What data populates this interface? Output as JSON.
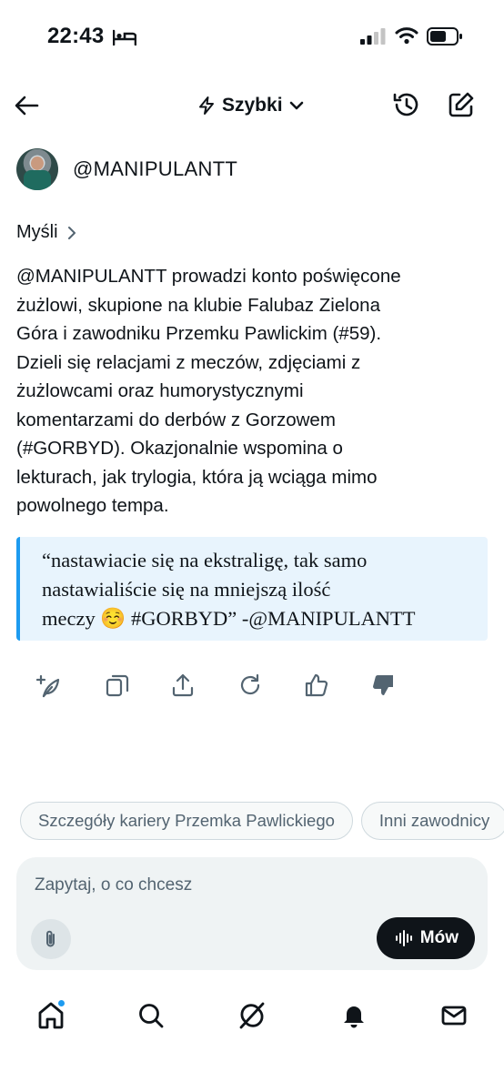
{
  "status_bar": {
    "time": "22:43"
  },
  "header": {
    "mode_label": "Szybki"
  },
  "profile": {
    "handle": "@MANIPULANTT"
  },
  "thoughts": {
    "label": "Myśli"
  },
  "summary": {
    "lines": [
      "@MANIPULANTT prowadzi konto poświęcone",
      "żużlowi, skupione na klubie Falubaz Zielona",
      "Góra i zawodniku Przemku Pawlickim (#59).",
      "Dzieli się relacjami z meczów, zdjęciami z",
      "żużlowcami oraz humorystycznymi",
      "komentarzami do derbów z Gorzowem",
      "(#GORBYD). Okazjonalnie wspomina o",
      "lekturach, jak trylogia, która ją wciąga mimo",
      "powolnego tempa."
    ]
  },
  "quote": {
    "lines": [
      "“nastawiacie się na ekstraligę, tak samo",
      "nastawialiście się na mniejszą ilość",
      "meczy ☺️ #GORBYD” -@MANIPULANTT"
    ]
  },
  "suggestions": [
    "Szczegóły kariery Przemka Pawlickiego",
    "Inni zawodnicy"
  ],
  "ask": {
    "placeholder": "Zapytaj, o co chcesz",
    "speak_label": "Mów"
  },
  "colors": {
    "accent": "#1d9bf0",
    "text": "#0f1419",
    "muted": "#536471",
    "quote_bg": "#e8f4fd"
  }
}
